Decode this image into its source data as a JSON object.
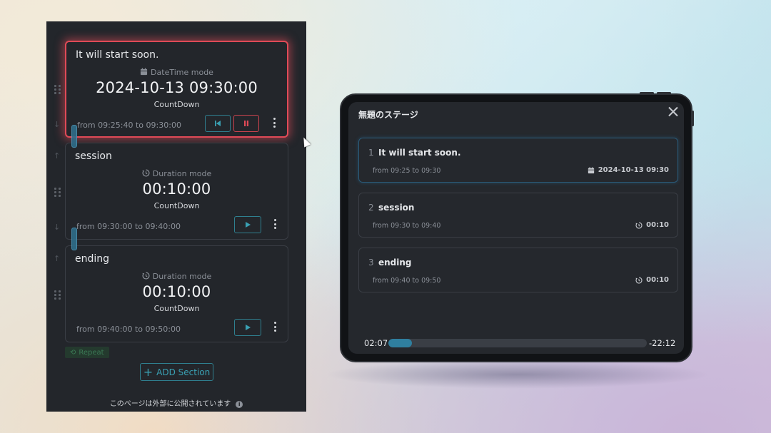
{
  "editor": {
    "sections": [
      {
        "title": "It will start soon.",
        "mode_icon": "calendar-icon",
        "mode": "DateTime mode",
        "value": "2024-10-13 09:30:00",
        "kind": "CountDown",
        "range": "from 09:25:40 to 09:30:00",
        "active": true
      },
      {
        "title": "session",
        "mode_icon": "history-icon",
        "mode": "Duration mode",
        "value": "00:10:00",
        "kind": "CountDown",
        "range": "from 09:30:00 to 09:40:00",
        "active": false
      },
      {
        "title": "ending",
        "mode_icon": "history-icon",
        "mode": "Duration mode",
        "value": "00:10:00",
        "kind": "CountDown",
        "range": "from 09:40:00 to 09:50:00",
        "active": false
      }
    ],
    "repeat_label": "Repeat",
    "add_section_label": "ADD Section",
    "notice": "このページは外部に公開されています"
  },
  "preview": {
    "title": "無題のステージ",
    "rows": [
      {
        "num": "1",
        "title": "It will start soon.",
        "range": "from 09:25 to 09:30",
        "icon": "calendar-icon",
        "value": "2024-10-13 09:30"
      },
      {
        "num": "2",
        "title": "session",
        "range": "from 09:30 to 09:40",
        "icon": "history-icon",
        "value": "00:10"
      },
      {
        "num": "3",
        "title": "ending",
        "range": "from 09:40 to 09:50",
        "icon": "history-icon",
        "value": "00:10"
      }
    ],
    "elapsed": "02:07",
    "remaining": "-22:12",
    "progress": 0.09
  },
  "colors": {
    "accent_teal": "#3aa0b3",
    "active_red": "#e04a57",
    "panel_bg": "#23262b"
  }
}
